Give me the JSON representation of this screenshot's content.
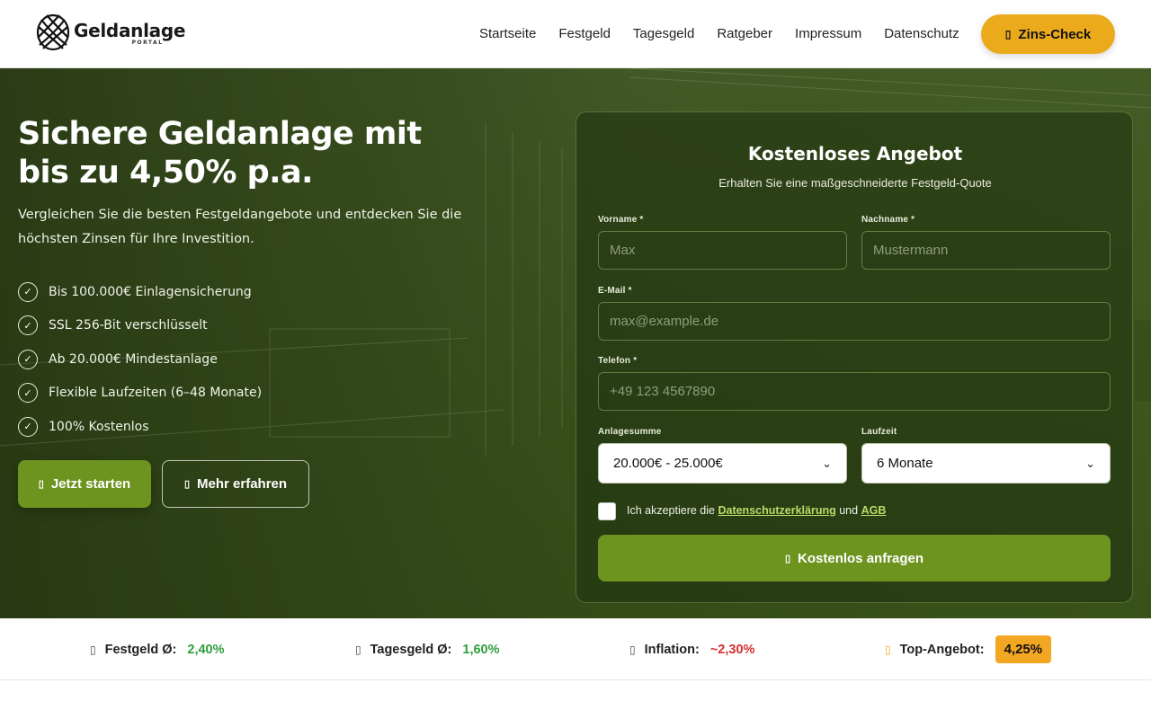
{
  "header": {
    "logo_name": "Geldanlage",
    "logo_sub": "PORTAL",
    "nav": [
      "Startseite",
      "Festgeld",
      "Tagesgeld",
      "Ratgeber",
      "Impressum",
      "Datenschutz"
    ],
    "cta_label": "Zins-Check",
    "cta_color": "#eba91c"
  },
  "hero": {
    "title_line1": "Sichere Geldanlage mit",
    "title_line2": "bis zu 4,50% p.a.",
    "description": "Vergleichen Sie die besten Festgeldangebote und entdecken Sie die höchsten Zinsen für Ihre Investition.",
    "features": [
      "Bis 100.000€ Einlagensicherung",
      "SSL 256-Bit verschlüsselt",
      "Ab 20.000€ Mindestanlage",
      "Flexible Laufzeiten (6–48 Monate)",
      "100% Kostenlos"
    ],
    "primary_button": "Jetzt starten",
    "secondary_button": "Mehr erfahren",
    "accent": "#6e9420"
  },
  "form": {
    "title": "Kostenloses Angebot",
    "subtitle": "Erhalten Sie eine maßgeschneiderte Festgeld-Quote",
    "first_name_label": "Vorname *",
    "first_name_placeholder": "Max",
    "last_name_label": "Nachname *",
    "last_name_placeholder": "Mustermann",
    "email_label": "E-Mail *",
    "email_placeholder": "max@example.de",
    "phone_label": "Telefon *",
    "phone_placeholder": "+49 123 4567890",
    "amount_label": "Anlagesumme",
    "amount_value": "20.000€ - 25.000€",
    "term_label": "Laufzeit",
    "term_value": "6 Monate",
    "consent_prefix": "Ich akzeptiere die",
    "consent_link1": "Datenschutzerklärung",
    "consent_and": "und",
    "consent_link2": "AGB",
    "submit_label": "Kostenlos anfragen"
  },
  "ticker": [
    {
      "label": "Festgeld Ø:",
      "value": "2,40%",
      "tone": "green"
    },
    {
      "label": "Tagesgeld Ø:",
      "value": "1,60%",
      "tone": "green"
    },
    {
      "label": "Inflation:",
      "value": "~2,30%",
      "tone": "red"
    },
    {
      "label": "Top-Angebot:",
      "value": "4,25%",
      "tone": "badge"
    }
  ]
}
